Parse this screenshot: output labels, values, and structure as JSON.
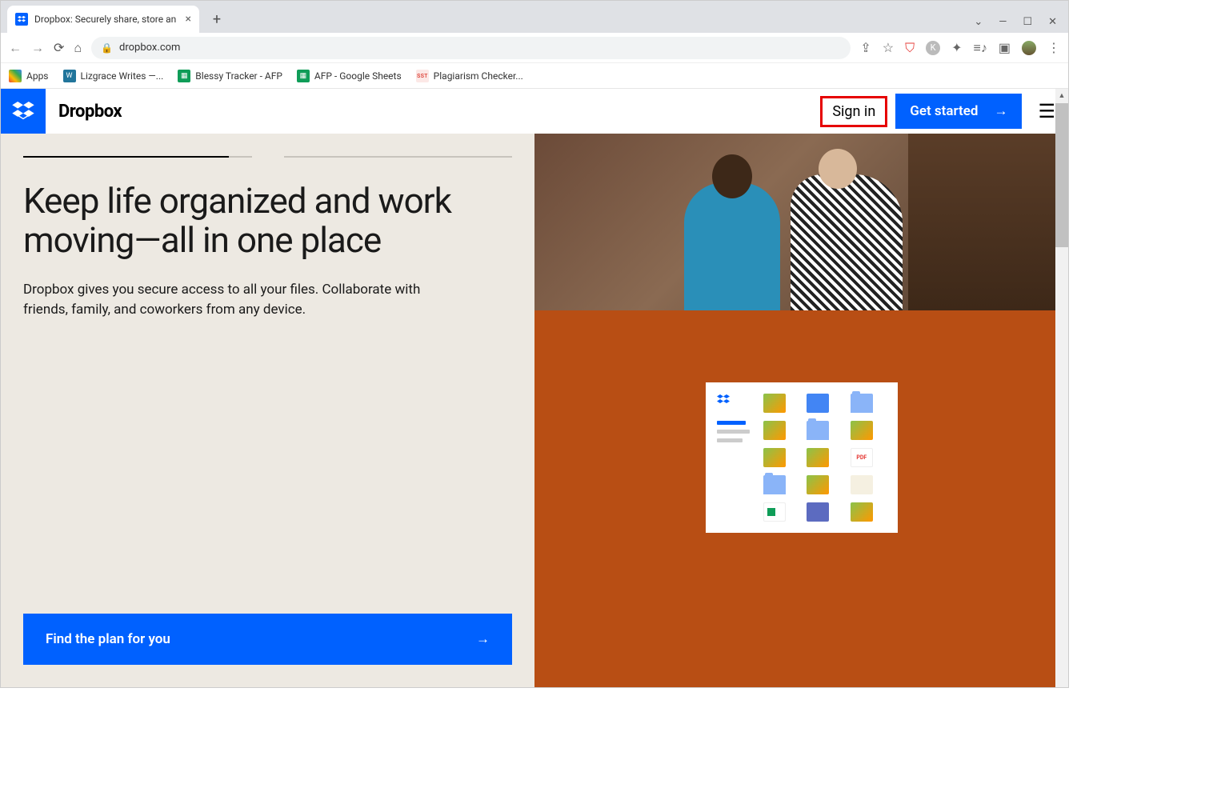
{
  "browser": {
    "tab_title": "Dropbox: Securely share, store an",
    "url": "dropbox.com",
    "bookmarks": [
      {
        "label": "Apps",
        "color": "apps"
      },
      {
        "label": "Lizgrace Writes —...",
        "color": "#21759b"
      },
      {
        "label": "Blessy Tracker - AFP",
        "color": "#0f9d58"
      },
      {
        "label": "AFP - Google Sheets",
        "color": "#0f9d58"
      },
      {
        "label": "Plagiarism Checker...",
        "color": "#e57373"
      }
    ]
  },
  "header": {
    "brand": "Dropbox",
    "signin": "Sign in",
    "getstarted": "Get started"
  },
  "hero": {
    "title": "Keep life organized and work moving—all in one place",
    "subtitle": "Dropbox gives you secure access to all your files. Collaborate with friends, family, and coworkers from any device.",
    "cta": "Find the plan for you"
  },
  "file_panel": {
    "pdf_label": "PDF"
  }
}
